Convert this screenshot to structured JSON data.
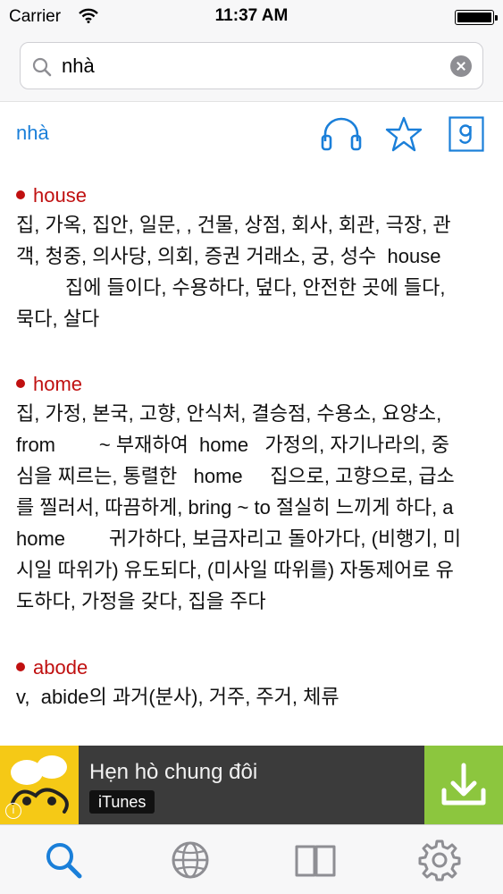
{
  "status_bar": {
    "carrier": "Carrier",
    "time": "11:37 AM",
    "battery_level": 1.0
  },
  "search": {
    "value": "nhà",
    "icon": "search-icon",
    "clear_icon": "clear-icon"
  },
  "word_header": {
    "word": "nhà",
    "icons": [
      "headphones-icon",
      "star-icon",
      "google-icon"
    ]
  },
  "entries": [
    {
      "term": "house",
      "definition": "집, 가옥, 집안, 일문, , 건물, 상점, 회사, 회관, 극장, 관\n객, 청중, 의사당, 의회, 증권 거래소, 궁, 성수  house\n         집에 들이다, 수용하다, 덮다, 안전한 곳에 들다,\n묵다, 살다"
    },
    {
      "term": "home",
      "definition": "집, 가정, 본국, 고향, 안식처, 결승점, 수용소, 요양소,\nfrom        ~ 부재하여  home   가정의, 자기나라의, 중\n심을 찌르는, 통렬한   home     집으로, 고향으로, 급소\n를 찔러서, 따끔하게, bring ~ to 절실히 느끼게 하다, a\nhome        귀가하다, 보금자리고 돌아가다, (비행기, 미\n시일 따위가) 유도되다, (미사일 따위를) 자동제어로 유\n도하다, 가정을 갖다, 집을 주다"
    },
    {
      "term": "abode",
      "definition": "v,  abide의 과거(분사), 거주, 주거, 체류"
    }
  ],
  "ad": {
    "title": "Hẹn hò chung đôi",
    "badge": "iTunes",
    "icons": [
      "app-logo-icon",
      "download-icon",
      "info-icon"
    ],
    "colors": {
      "logo_bg": "#f5c916",
      "download_bg": "#8cc63e",
      "banner_bg": "#3b3b3b"
    }
  },
  "tab_bar": {
    "tabs": [
      {
        "icon": "search-tab-icon",
        "active": true
      },
      {
        "icon": "globe-icon",
        "active": false
      },
      {
        "icon": "book-icon",
        "active": false
      },
      {
        "icon": "gear-icon",
        "active": false
      }
    ]
  },
  "colors": {
    "accent": "#1a7fd9",
    "term": "#c01010"
  }
}
